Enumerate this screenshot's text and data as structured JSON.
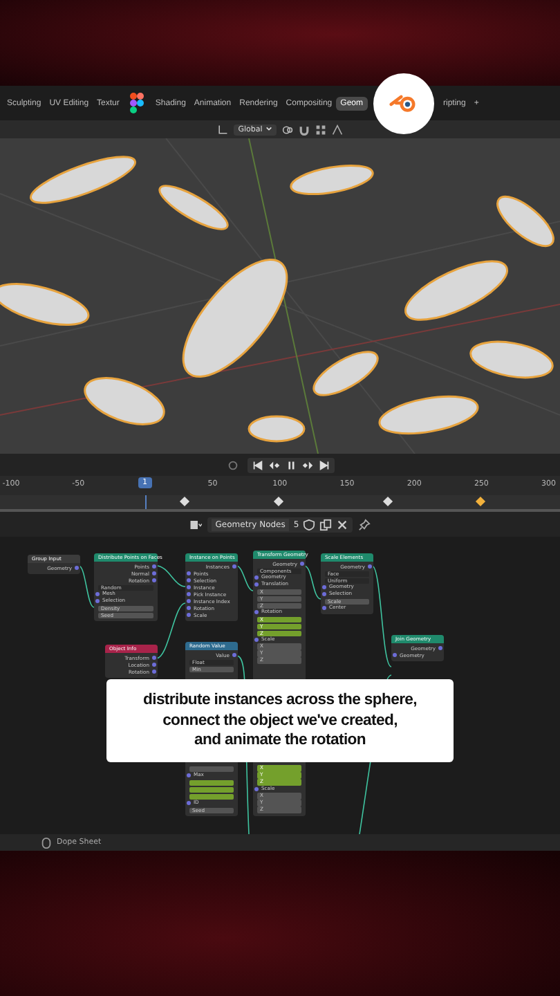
{
  "workspace_tabs": [
    {
      "label": "Sculpting",
      "selected": false
    },
    {
      "label": "UV Editing",
      "selected": false
    },
    {
      "label": "Textur",
      "selected": false
    },
    {
      "label": "Shading",
      "selected": false
    },
    {
      "label": "Animation",
      "selected": false
    },
    {
      "label": "Rendering",
      "selected": false
    },
    {
      "label": "Compositing",
      "selected": false
    },
    {
      "label": "Geom",
      "selected": true
    },
    {
      "label": "ripting",
      "selected": false
    }
  ],
  "add_tab": "+",
  "viewport": {
    "orientation": "Global",
    "kind": "picture"
  },
  "timeline": {
    "ticks": [
      "-100",
      "-50",
      "50",
      "100",
      "150",
      "200",
      "250",
      "300"
    ],
    "current_frame": "1",
    "keyframes": [
      {
        "selected": false
      },
      {
        "selected": false
      },
      {
        "selected": false
      },
      {
        "selected": true
      }
    ]
  },
  "node_editor": {
    "tree_name": "Geometry Nodes",
    "users": "5",
    "nodes": [
      {
        "title": "Group Input",
        "color": "#3c3c3c",
        "rows": [
          {
            "kind": "out",
            "label": "Geometry"
          }
        ]
      },
      {
        "title": "Distribute Points on Faces",
        "color": "#1f8a6c",
        "rows": [
          {
            "kind": "out",
            "label": "Points"
          },
          {
            "kind": "out",
            "label": "Normal"
          },
          {
            "kind": "out",
            "label": "Rotation"
          },
          {
            "kind": "dropdown",
            "label": "Random"
          },
          {
            "kind": "in",
            "label": "Mesh"
          },
          {
            "kind": "in",
            "label": "Selection"
          },
          {
            "kind": "field",
            "label": "Density"
          },
          {
            "kind": "field",
            "label": "Seed"
          }
        ]
      },
      {
        "title": "Instance on Points",
        "color": "#1f8a6c",
        "rows": [
          {
            "kind": "out",
            "label": "Instances"
          },
          {
            "kind": "in",
            "label": "Points"
          },
          {
            "kind": "in",
            "label": "Selection"
          },
          {
            "kind": "in",
            "label": "Instance"
          },
          {
            "kind": "in",
            "label": "Pick Instance"
          },
          {
            "kind": "in",
            "label": "Instance Index"
          },
          {
            "kind": "in",
            "label": "Rotation"
          },
          {
            "kind": "in",
            "label": "Scale"
          }
        ]
      },
      {
        "title": "Transform Geometry",
        "color": "#1f8a6c",
        "rows": [
          {
            "kind": "out",
            "label": "Geometry"
          },
          {
            "kind": "dropdown",
            "label": "Components"
          },
          {
            "kind": "in",
            "label": "Geometry"
          },
          {
            "kind": "in",
            "label": "Translation"
          },
          {
            "kind": "field",
            "label": "X"
          },
          {
            "kind": "field",
            "label": "Y"
          },
          {
            "kind": "field",
            "label": "Z"
          },
          {
            "kind": "in",
            "label": "Rotation"
          },
          {
            "kind": "animated",
            "label": "X"
          },
          {
            "kind": "animated",
            "label": "Y"
          },
          {
            "kind": "animated",
            "label": "Z"
          },
          {
            "kind": "in",
            "label": "Scale"
          },
          {
            "kind": "field",
            "label": "X"
          },
          {
            "kind": "field",
            "label": "Y"
          },
          {
            "kind": "field",
            "label": "Z"
          },
          {
            "kind": "covered"
          },
          {
            "kind": "animated",
            "label": "X"
          },
          {
            "kind": "animated",
            "label": "Y"
          },
          {
            "kind": "animated",
            "label": "Z"
          },
          {
            "kind": "in",
            "label": "Scale"
          },
          {
            "kind": "field",
            "label": "X"
          },
          {
            "kind": "field",
            "label": "Y"
          },
          {
            "kind": "field",
            "label": "Z"
          }
        ]
      },
      {
        "title": "Scale Elements",
        "color": "#1f8a6c",
        "rows": [
          {
            "kind": "out",
            "label": "Geometry"
          },
          {
            "kind": "dropdown",
            "label": "Face"
          },
          {
            "kind": "dropdown",
            "label": "Uniform"
          },
          {
            "kind": "in",
            "label": "Geometry"
          },
          {
            "kind": "in",
            "label": "Selection"
          },
          {
            "kind": "field",
            "label": "Scale"
          },
          {
            "kind": "in",
            "label": "Center"
          }
        ]
      },
      {
        "title": "Join Geometry",
        "color": "#1f8a6c",
        "rows": [
          {
            "kind": "out",
            "label": "Geometry"
          },
          {
            "kind": "in",
            "label": "Geometry"
          }
        ]
      },
      {
        "title": "Object Info",
        "color": "#a8234a",
        "rows": [
          {
            "kind": "out",
            "label": "Transform"
          },
          {
            "kind": "out",
            "label": "Location"
          },
          {
            "kind": "out",
            "label": "Rotation"
          }
        ]
      },
      {
        "title": "Random Value",
        "color": "#2e6b8f",
        "rows": [
          {
            "kind": "out",
            "label": "Value"
          },
          {
            "kind": "dropdown",
            "label": "Float"
          },
          {
            "kind": "field",
            "label": "Min"
          },
          {
            "kind": "covered"
          },
          {
            "kind": "field"
          },
          {
            "kind": "in",
            "label": "Max"
          },
          {
            "kind": "animated"
          },
          {
            "kind": "animated"
          },
          {
            "kind": "animated"
          },
          {
            "kind": "in",
            "label": "ID"
          },
          {
            "kind": "field",
            "label": "Seed"
          }
        ]
      }
    ]
  },
  "caption": "distribute instances across the sphere,\nconnect the object we've created,\nand animate the rotation",
  "footer": {
    "editor": "Dope Sheet"
  }
}
